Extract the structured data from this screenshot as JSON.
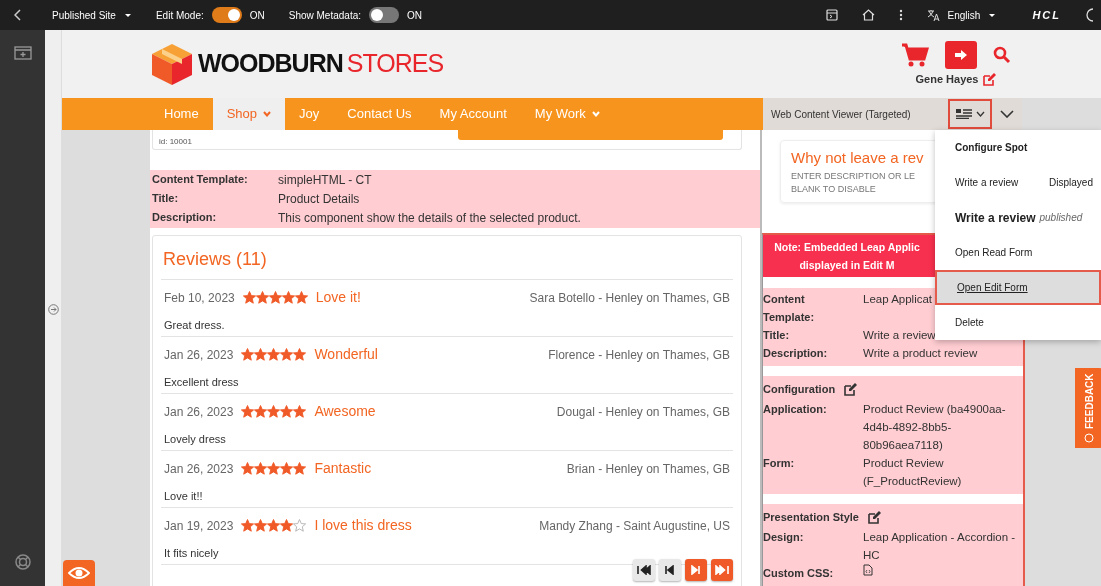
{
  "toolbar": {
    "site": "Published Site",
    "edit_mode": {
      "label": "Edit Mode:",
      "on": true,
      "state": "ON"
    },
    "show_metadata": {
      "label": "Show Metadata:",
      "on": false,
      "state": "ON"
    },
    "language": "English",
    "brand": "HCL"
  },
  "header": {
    "logo_brand": "WOODBURN",
    "logo_suffix": "STORES",
    "user": "Gene Hayes"
  },
  "nav": [
    {
      "label": "Home",
      "selected": false,
      "has_menu": false
    },
    {
      "label": "Shop",
      "selected": true,
      "has_menu": true
    },
    {
      "label": "Joy",
      "selected": false,
      "has_menu": false
    },
    {
      "label": "Contact Us",
      "selected": false,
      "has_menu": false
    },
    {
      "label": "My Account",
      "selected": false,
      "has_menu": false
    },
    {
      "label": "My Work",
      "selected": false,
      "has_menu": true
    }
  ],
  "portlet_bar": {
    "title": "Web Content Viewer (Targeted)",
    "menu_expanded": true
  },
  "product_card": {
    "id_text": "id: 10001"
  },
  "metadata": [
    {
      "label": "Content Template:",
      "value": "simpleHTML - CT"
    },
    {
      "label": "Title:",
      "value": "Product Details"
    },
    {
      "label": "Description:",
      "value": "This component show the details of the selected product."
    }
  ],
  "reviews": {
    "title": "Reviews (11)",
    "items": [
      {
        "date": "Feb 10, 2023",
        "stars": 5,
        "title": "Love it!",
        "author": "Sara Botello - Henley on Thames, GB",
        "body": "Great dress."
      },
      {
        "date": "Jan 26, 2023",
        "stars": 5,
        "title": "Wonderful",
        "author": "Florence - Henley on Thames, GB",
        "body": "Excellent dress"
      },
      {
        "date": "Jan 26, 2023",
        "stars": 5,
        "title": "Awesome",
        "author": "Dougal - Henley on Thames, GB",
        "body": "Lovely dress"
      },
      {
        "date": "Jan 26, 2023",
        "stars": 5,
        "title": "Fantastic",
        "author": "Brian - Henley on Thames, GB",
        "body": "Love it!!"
      },
      {
        "date": "Jan 19, 2023",
        "stars": 4,
        "title": "I love this dress",
        "author": "Mandy Zhang - Saint Augustine, US",
        "body": "It fits nicely"
      }
    ],
    "pager": [
      {
        "kind": "first",
        "disabled": true
      },
      {
        "kind": "prev",
        "disabled": true
      },
      {
        "kind": "next",
        "disabled": false
      },
      {
        "kind": "last",
        "disabled": false
      }
    ]
  },
  "review_prompt": {
    "title": "Why not leave a rev",
    "hint_lines": [
      "ENTER DESCRIPTION OR LE",
      "BLANK TO DISABLE"
    ]
  },
  "leap_panel": {
    "note_lines": [
      "Note: Embedded Leap Applic",
      "displayed in Edit M"
    ],
    "sections": [
      {
        "rows": [
          {
            "kind": "text",
            "label": "Content Template:",
            "value": "Leap Applicat"
          },
          {
            "kind": "text",
            "label": "Title:",
            "value": "Write a review"
          },
          {
            "kind": "text",
            "label": "Description:",
            "value": "Write a product review"
          }
        ]
      },
      {
        "heading": "Configuration",
        "rows": [
          {
            "kind": "text",
            "label": "Application:",
            "value": "Product Review  (ba4900aa-4d4b-4892-8bb5-80b96aea7118)"
          },
          {
            "kind": "text",
            "label": "Form:",
            "value": "Product Review  (F_ProductReview)"
          }
        ]
      },
      {
        "heading": "Presentation Style",
        "rows": [
          {
            "kind": "text",
            "label": "Design:",
            "value": "Leap Application - Accordion - HC"
          },
          {
            "kind": "file",
            "label": "Custom CSS:"
          }
        ]
      }
    ]
  },
  "context_menu": [
    {
      "kind": "header",
      "label": "Configure Spot"
    },
    {
      "kind": "pair",
      "label": "Write a review",
      "note": "Displayed"
    },
    {
      "kind": "title",
      "label": "Write a review",
      "note": "published"
    },
    {
      "kind": "action",
      "label": "Open Read Form",
      "selected": false
    },
    {
      "kind": "action",
      "label": "Open Edit Form",
      "selected": true
    },
    {
      "kind": "action",
      "label": "Delete",
      "selected": false
    }
  ],
  "feedback": "FEEDBACK"
}
